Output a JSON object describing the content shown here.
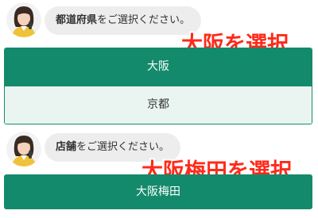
{
  "block1": {
    "prompt_bold": "都道府県",
    "prompt_rest": "をご選択ください。",
    "annotation": "大阪を選択",
    "options": [
      "大阪",
      "京都"
    ]
  },
  "block2": {
    "prompt_bold": "店舗",
    "prompt_rest": "をご選択ください。",
    "annotation": "大阪梅田を選択",
    "options": [
      "大阪梅田"
    ]
  },
  "colors": {
    "accent": "#148a6c",
    "option_bg": "#eaf5f2",
    "bubble_bg": "#ededed",
    "annotation": "#ff2a1a"
  },
  "icons": {
    "avatar": "operator-avatar-icon"
  }
}
